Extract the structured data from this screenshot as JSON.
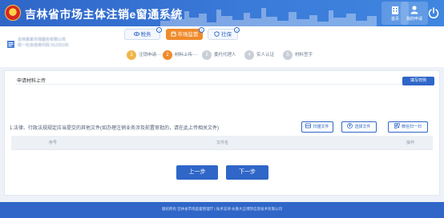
{
  "app": {
    "title": "吉林省市场主体注销e窗通系统"
  },
  "header": {
    "home_label": "首页",
    "mine_label": "我的申请"
  },
  "user": {
    "line1": "吉林某某市场服务有限公司",
    "line2": "统一社会信用代码 91220100"
  },
  "tabs": [
    {
      "label": "税务",
      "icon": "eye-icon",
      "active": false
    },
    {
      "label": "市场监管",
      "icon": "store-icon",
      "active": true
    },
    {
      "label": "社保",
      "icon": "shield-icon",
      "active": false
    }
  ],
  "steps": [
    {
      "num": "1",
      "label": "注销申请"
    },
    {
      "num": "2",
      "label": "材料上传"
    },
    {
      "num": "3",
      "label": "委托代理人"
    },
    {
      "num": "4",
      "label": "实人认证"
    },
    {
      "num": "5",
      "label": "材料签字"
    }
  ],
  "section": {
    "title": "申请材料上传",
    "sample_button": "填写样例"
  },
  "document": {
    "label": "1.法律、行政法规规定应当提交的其他文件(如办理注销业务涉及前置审批的，请在此上传相关文件)",
    "scan_button": "扫描文件",
    "choose_button": "选择文件",
    "wechat_button": "微信扫一扫"
  },
  "table": {
    "headers": [
      "序号",
      "文件名",
      "操作"
    ]
  },
  "nav": {
    "prev": "上一步",
    "next": "下一步"
  },
  "footer": {
    "text": "版权所有:吉林省市场监督管理厅 | 技术支持:长春大正博凯信息技术有限公司"
  },
  "colors": {
    "primary": "#2f66c8",
    "accent": "#f08a2a"
  }
}
